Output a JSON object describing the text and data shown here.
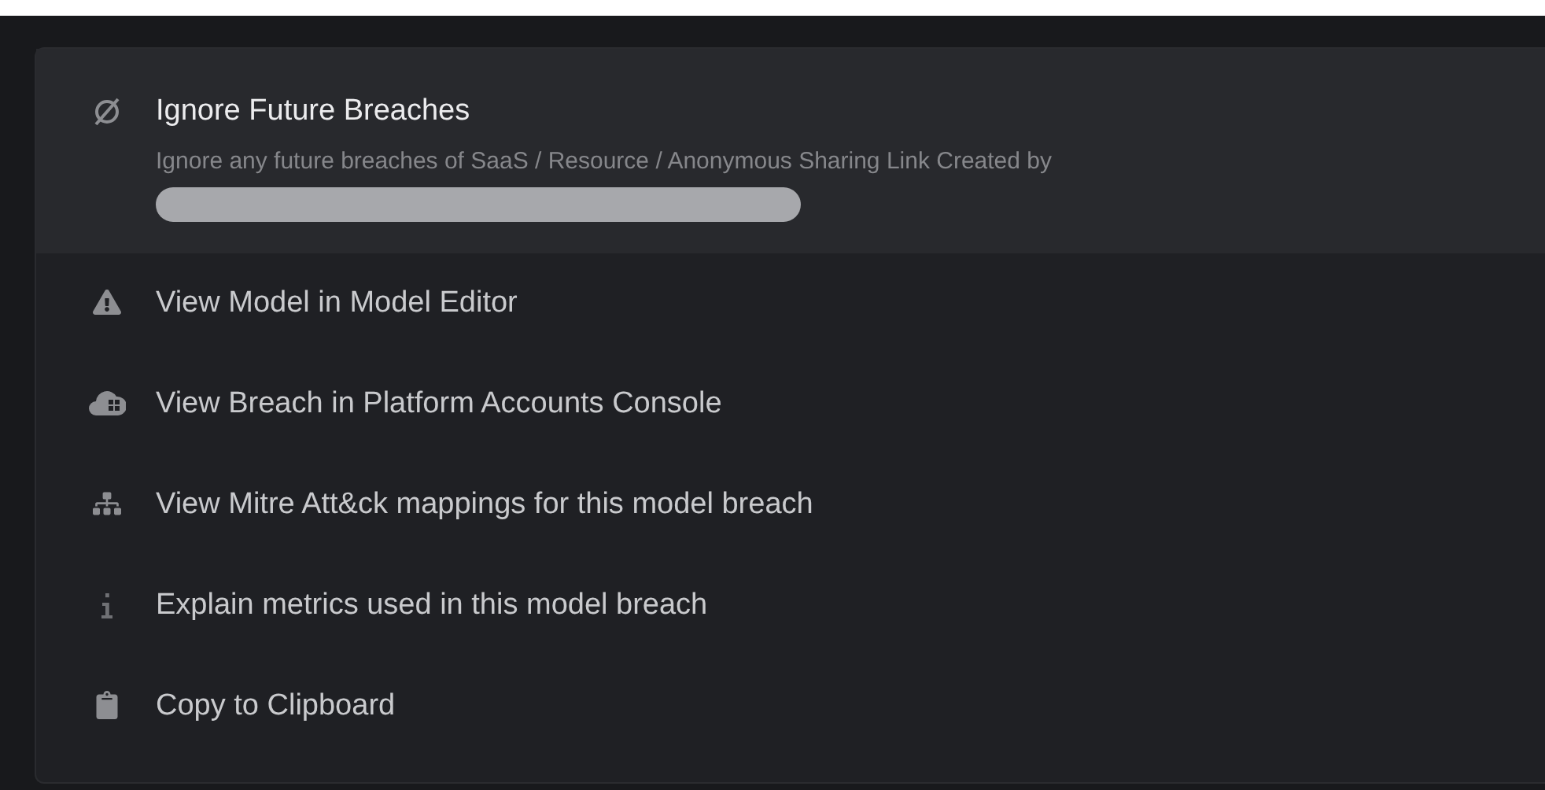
{
  "menu": {
    "items": [
      {
        "label": "Ignore Future Breaches",
        "description": "Ignore any future breaches of SaaS / Resource / Anonymous Sharing Link Created by",
        "redacted": true,
        "selected": true
      },
      {
        "label": "View Model in Model Editor",
        "selected": false
      },
      {
        "label": "View Breach in Platform Accounts Console",
        "selected": false
      },
      {
        "label": "View Mitre Att&ck mappings for this model breach",
        "selected": false
      },
      {
        "label": "Explain metrics used in this model breach",
        "selected": false
      },
      {
        "label": "Copy to Clipboard",
        "selected": false
      }
    ]
  }
}
